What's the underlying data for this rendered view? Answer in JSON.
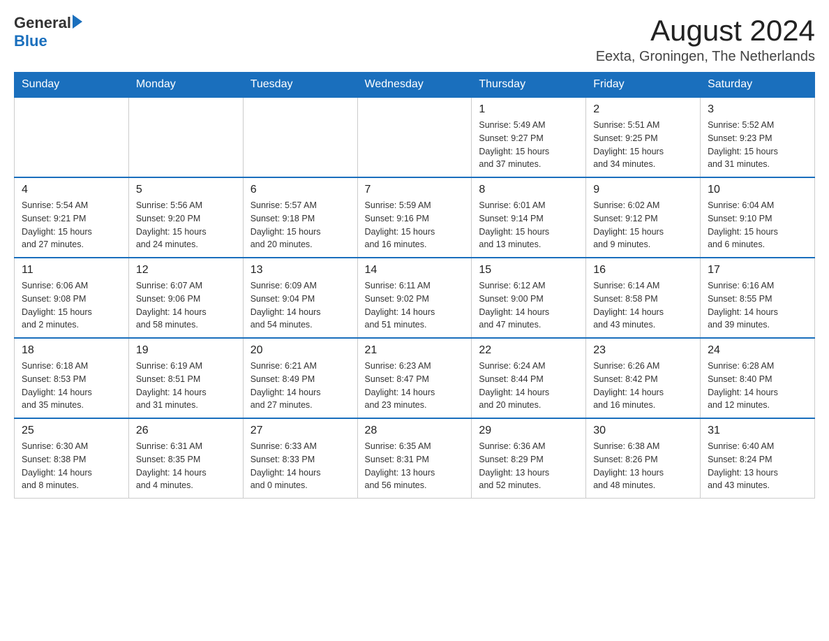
{
  "header": {
    "logo_general": "General",
    "logo_blue": "Blue",
    "month_title": "August 2024",
    "location": "Eexta, Groningen, The Netherlands"
  },
  "weekdays": [
    "Sunday",
    "Monday",
    "Tuesday",
    "Wednesday",
    "Thursday",
    "Friday",
    "Saturday"
  ],
  "weeks": [
    [
      {
        "day": "",
        "info": ""
      },
      {
        "day": "",
        "info": ""
      },
      {
        "day": "",
        "info": ""
      },
      {
        "day": "",
        "info": ""
      },
      {
        "day": "1",
        "info": "Sunrise: 5:49 AM\nSunset: 9:27 PM\nDaylight: 15 hours\nand 37 minutes."
      },
      {
        "day": "2",
        "info": "Sunrise: 5:51 AM\nSunset: 9:25 PM\nDaylight: 15 hours\nand 34 minutes."
      },
      {
        "day": "3",
        "info": "Sunrise: 5:52 AM\nSunset: 9:23 PM\nDaylight: 15 hours\nand 31 minutes."
      }
    ],
    [
      {
        "day": "4",
        "info": "Sunrise: 5:54 AM\nSunset: 9:21 PM\nDaylight: 15 hours\nand 27 minutes."
      },
      {
        "day": "5",
        "info": "Sunrise: 5:56 AM\nSunset: 9:20 PM\nDaylight: 15 hours\nand 24 minutes."
      },
      {
        "day": "6",
        "info": "Sunrise: 5:57 AM\nSunset: 9:18 PM\nDaylight: 15 hours\nand 20 minutes."
      },
      {
        "day": "7",
        "info": "Sunrise: 5:59 AM\nSunset: 9:16 PM\nDaylight: 15 hours\nand 16 minutes."
      },
      {
        "day": "8",
        "info": "Sunrise: 6:01 AM\nSunset: 9:14 PM\nDaylight: 15 hours\nand 13 minutes."
      },
      {
        "day": "9",
        "info": "Sunrise: 6:02 AM\nSunset: 9:12 PM\nDaylight: 15 hours\nand 9 minutes."
      },
      {
        "day": "10",
        "info": "Sunrise: 6:04 AM\nSunset: 9:10 PM\nDaylight: 15 hours\nand 6 minutes."
      }
    ],
    [
      {
        "day": "11",
        "info": "Sunrise: 6:06 AM\nSunset: 9:08 PM\nDaylight: 15 hours\nand 2 minutes."
      },
      {
        "day": "12",
        "info": "Sunrise: 6:07 AM\nSunset: 9:06 PM\nDaylight: 14 hours\nand 58 minutes."
      },
      {
        "day": "13",
        "info": "Sunrise: 6:09 AM\nSunset: 9:04 PM\nDaylight: 14 hours\nand 54 minutes."
      },
      {
        "day": "14",
        "info": "Sunrise: 6:11 AM\nSunset: 9:02 PM\nDaylight: 14 hours\nand 51 minutes."
      },
      {
        "day": "15",
        "info": "Sunrise: 6:12 AM\nSunset: 9:00 PM\nDaylight: 14 hours\nand 47 minutes."
      },
      {
        "day": "16",
        "info": "Sunrise: 6:14 AM\nSunset: 8:58 PM\nDaylight: 14 hours\nand 43 minutes."
      },
      {
        "day": "17",
        "info": "Sunrise: 6:16 AM\nSunset: 8:55 PM\nDaylight: 14 hours\nand 39 minutes."
      }
    ],
    [
      {
        "day": "18",
        "info": "Sunrise: 6:18 AM\nSunset: 8:53 PM\nDaylight: 14 hours\nand 35 minutes."
      },
      {
        "day": "19",
        "info": "Sunrise: 6:19 AM\nSunset: 8:51 PM\nDaylight: 14 hours\nand 31 minutes."
      },
      {
        "day": "20",
        "info": "Sunrise: 6:21 AM\nSunset: 8:49 PM\nDaylight: 14 hours\nand 27 minutes."
      },
      {
        "day": "21",
        "info": "Sunrise: 6:23 AM\nSunset: 8:47 PM\nDaylight: 14 hours\nand 23 minutes."
      },
      {
        "day": "22",
        "info": "Sunrise: 6:24 AM\nSunset: 8:44 PM\nDaylight: 14 hours\nand 20 minutes."
      },
      {
        "day": "23",
        "info": "Sunrise: 6:26 AM\nSunset: 8:42 PM\nDaylight: 14 hours\nand 16 minutes."
      },
      {
        "day": "24",
        "info": "Sunrise: 6:28 AM\nSunset: 8:40 PM\nDaylight: 14 hours\nand 12 minutes."
      }
    ],
    [
      {
        "day": "25",
        "info": "Sunrise: 6:30 AM\nSunset: 8:38 PM\nDaylight: 14 hours\nand 8 minutes."
      },
      {
        "day": "26",
        "info": "Sunrise: 6:31 AM\nSunset: 8:35 PM\nDaylight: 14 hours\nand 4 minutes."
      },
      {
        "day": "27",
        "info": "Sunrise: 6:33 AM\nSunset: 8:33 PM\nDaylight: 14 hours\nand 0 minutes."
      },
      {
        "day": "28",
        "info": "Sunrise: 6:35 AM\nSunset: 8:31 PM\nDaylight: 13 hours\nand 56 minutes."
      },
      {
        "day": "29",
        "info": "Sunrise: 6:36 AM\nSunset: 8:29 PM\nDaylight: 13 hours\nand 52 minutes."
      },
      {
        "day": "30",
        "info": "Sunrise: 6:38 AM\nSunset: 8:26 PM\nDaylight: 13 hours\nand 48 minutes."
      },
      {
        "day": "31",
        "info": "Sunrise: 6:40 AM\nSunset: 8:24 PM\nDaylight: 13 hours\nand 43 minutes."
      }
    ]
  ]
}
